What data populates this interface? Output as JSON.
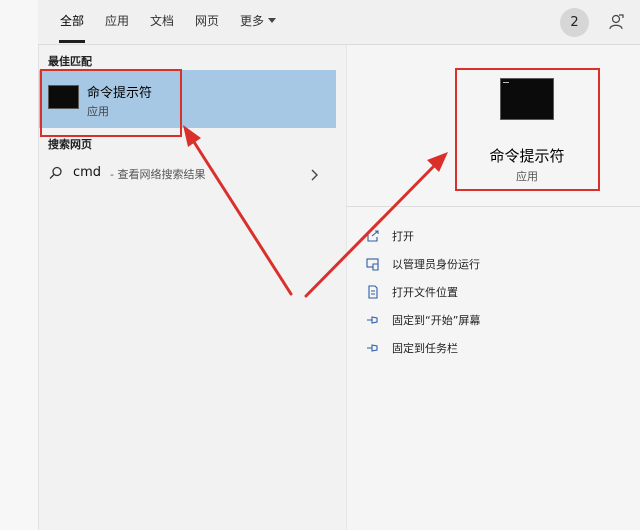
{
  "tabs": [
    {
      "label": "全部",
      "active": true
    },
    {
      "label": "应用"
    },
    {
      "label": "文档"
    },
    {
      "label": "网页"
    },
    {
      "label": "更多"
    }
  ],
  "header": {
    "badge": "2"
  },
  "left": {
    "best_match_label": "最佳匹配",
    "best_match": {
      "title": "命令提示符",
      "subtitle": "应用"
    },
    "web_label": "搜索网页",
    "web_query": "cmd",
    "web_hint": "- 查看网络搜索结果"
  },
  "right": {
    "title": "命令提示符",
    "subtitle": "应用",
    "actions": [
      {
        "label": "打开",
        "icon": "open-icon"
      },
      {
        "label": "以管理员身份运行",
        "icon": "admin-run-icon"
      },
      {
        "label": "打开文件位置",
        "icon": "file-location-icon"
      },
      {
        "label": "固定到“开始”屏幕",
        "icon": "pin-icon"
      },
      {
        "label": "固定到任务栏",
        "icon": "pin-icon"
      }
    ]
  },
  "colors": {
    "accent": "#a6c8e4",
    "annotation": "#d9302b"
  }
}
